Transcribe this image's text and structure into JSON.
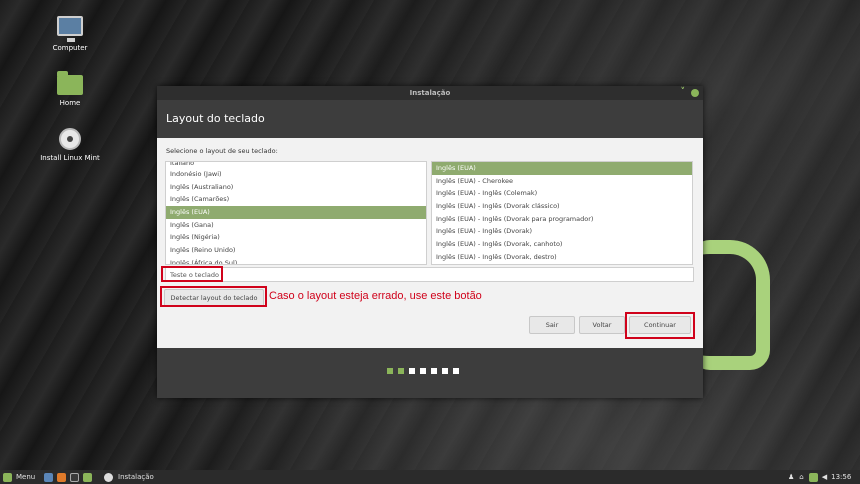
{
  "desktop": {
    "icons": [
      {
        "label": "Computer"
      },
      {
        "label": "Home"
      },
      {
        "label": "Install Linux Mint"
      }
    ]
  },
  "window": {
    "title": "Instalação",
    "header": "Layout do teclado",
    "prompt": "Selecione o layout de seu teclado:",
    "left_list": {
      "items": [
        "Italiano",
        "Indonésio (Jawi)",
        "Inglês (Australiano)",
        "Inglês (Camarões)",
        "Inglês (EUA)",
        "Inglês (Gana)",
        "Inglês (Nigéria)",
        "Inglês (Reino Unido)",
        "Inglês (África do Sul)"
      ],
      "selected": "Inglês (EUA)"
    },
    "right_list": {
      "items": [
        "Inglês (EUA)",
        "Inglês (EUA) - Cherokee",
        "Inglês (EUA) - Inglês (Colemak)",
        "Inglês (EUA) - Inglês (Dvorak clássico)",
        "Inglês (EUA) - Inglês (Dvorak para programador)",
        "Inglês (EUA) - Inglês (Dvorak)",
        "Inglês (EUA) - Inglês (Dvorak, canhoto)",
        "Inglês (EUA) - Inglês (Dvorak, destro)"
      ],
      "selected": "Inglês (EUA)"
    },
    "test_input": {
      "value": "",
      "placeholder": "Teste o teclado"
    },
    "detect_button": "Detectar layout do teclado",
    "annotation": "Caso o layout esteja errado, use este botão",
    "quit_button": "Sair",
    "back_button": "Voltar",
    "continue_button": "Continuar",
    "progress": {
      "total": 7,
      "completed": 2
    }
  },
  "taskbar": {
    "menu_label": "Menu",
    "active_window": "Instalação",
    "clock": "13:56"
  },
  "colors": {
    "accent": "#8bb55a",
    "highlight": "#d0021b",
    "selection": "#8fab6f"
  }
}
